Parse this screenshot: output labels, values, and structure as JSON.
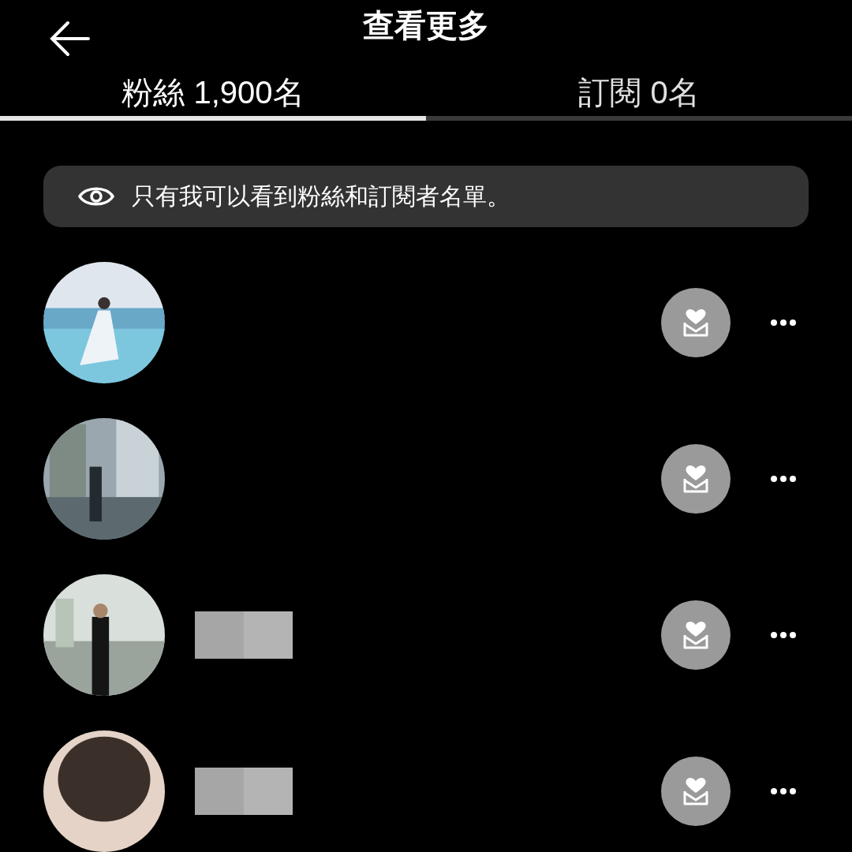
{
  "header": {
    "title": "查看更多"
  },
  "tabs": [
    {
      "label": "粉絲 1,900名",
      "selected": true
    },
    {
      "label": "訂閱 0名",
      "selected": false
    }
  ],
  "notice": {
    "text": "只有我可以看到粉絲和訂閱者名單。"
  },
  "followers": [
    {
      "name_redacted": false
    },
    {
      "name_redacted": false
    },
    {
      "name_redacted": true
    },
    {
      "name_redacted": true
    }
  ]
}
